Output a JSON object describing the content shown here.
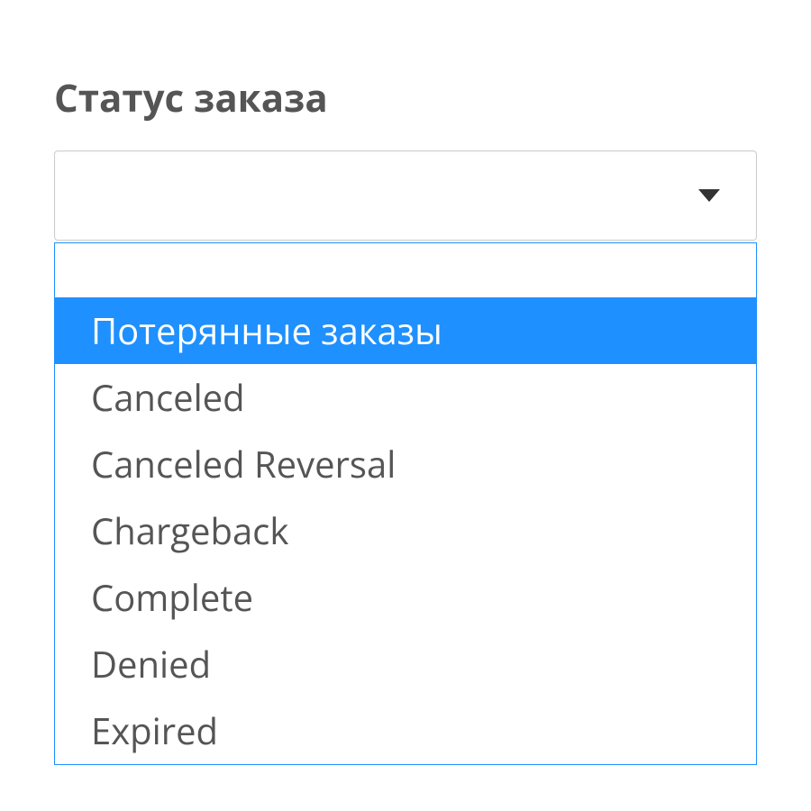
{
  "top_text": "",
  "label": "Статус заказа",
  "selected_value": "",
  "options": [
    {
      "label": "Потерянные заказы",
      "highlighted": true
    },
    {
      "label": "Canceled",
      "highlighted": false
    },
    {
      "label": "Canceled Reversal",
      "highlighted": false
    },
    {
      "label": "Chargeback",
      "highlighted": false
    },
    {
      "label": "Complete",
      "highlighted": false
    },
    {
      "label": "Denied",
      "highlighted": false
    },
    {
      "label": "Expired",
      "highlighted": false
    }
  ],
  "colors": {
    "highlight": "#1e90ff",
    "text": "#555555"
  }
}
